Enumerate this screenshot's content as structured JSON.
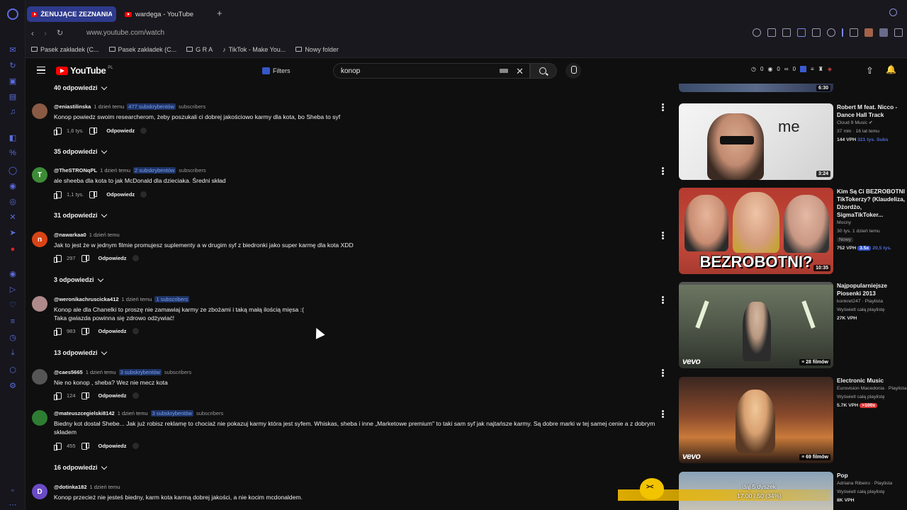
{
  "browser": {
    "tabs": [
      {
        "label": "ŻENUJĄCE ZEZNANIA STŁ"
      },
      {
        "label": "wardęga - YouTube"
      }
    ],
    "url": "www.youtube.com/watch",
    "bookmarks": [
      {
        "label": "Pasek zakładek (C..."
      },
      {
        "label": "Pasek zakładek (C..."
      },
      {
        "label": "G R A"
      },
      {
        "label": "TikTok - Make You..."
      },
      {
        "label": "Nowy folder"
      }
    ]
  },
  "youtube": {
    "logo_text": "YouTube",
    "country": "PL",
    "filters_label": "Filters",
    "search_value": "konop",
    "ext_counts": [
      "0",
      "0",
      "0"
    ]
  },
  "comments": [
    {
      "author": "@eniastilinska",
      "time": "1 dzień temu",
      "subs_highlight": "477 subskrybentów",
      "subs_tail": "subscribers",
      "text": "Konop powiedz swoim researcherom, żeby poszukali ci dobrej jakościowo karmy dla kota, bo Sheba to syf",
      "likes": "1,6 tys.",
      "reply": "Odpowiedz",
      "replies_label": "35 odpowiedzi",
      "avatar_letter": "",
      "avatar_color": "#8a5a44"
    },
    {
      "author": "@TheSTRONqPL",
      "time": "1 dzień temu",
      "subs_highlight": "2 subskrybentów",
      "subs_tail": "subscribers",
      "text": "ale sheeba dla kota to jak McDonald dla dzieciaka. Średni skład",
      "likes": "1,1 tys.",
      "reply": "Odpowiedz",
      "replies_label": "31 odpowiedzi",
      "avatar_letter": "T",
      "avatar_color": "#3d8b37"
    },
    {
      "author": "@nawarkaa0",
      "time": "1 dzień temu",
      "subs_highlight": "",
      "subs_tail": "",
      "text": "Jak to jest że w jednym filmie promujesz suplementy a w drugim syf z biedronki jako super karmę dla kota XDD",
      "likes": "297",
      "reply": "Odpowiedz",
      "replies_label": "3 odpowiedzi",
      "avatar_letter": "n",
      "avatar_color": "#d84315"
    },
    {
      "author": "@weronikachruscicka412",
      "time": "1 dzień temu",
      "subs_highlight": "1 subscribers",
      "subs_tail": "",
      "text": "Konop ale dla Chanelki to proszę nie zamawiaj karmy ze zbożami i taką małą ilością mięsa :(",
      "text2": "Taka gwiazda powinna się zdrowo odżywiać!",
      "likes": "983",
      "reply": "Odpowiedz",
      "replies_label": "13 odpowiedzi",
      "avatar_letter": "",
      "avatar_color": "#b08a8a"
    },
    {
      "author": "@caes5665",
      "time": "1 dzień temu",
      "subs_highlight": "3 subskrybentów",
      "subs_tail": "subscribers",
      "text": "Nie no konop , sheba? Wez nie mecz kota",
      "likes": "124",
      "reply": "Odpowiedz",
      "avatar_letter": "",
      "avatar_color": "#666"
    },
    {
      "author": "@mateuszcegielski8142",
      "time": "1 dzień temu",
      "subs_highlight": "3 subskrybentów",
      "subs_tail": "subscribers",
      "text": "Biedny kot dostał Shebe... Jak już robisz reklamę to chociaż nie pokazuj karmy która jest syfem. Whiskas, sheba i inne „Marketowe premium\" to taki sam syf jak najtańsze karmy. Są dobre marki w tej samej cenie a z dobrym składem",
      "likes": "455",
      "reply": "Odpowiedz",
      "replies_label": "16 odpowiedzi",
      "avatar_letter": "",
      "avatar_color": "#2e7d32"
    },
    {
      "author": "@dotinka182",
      "time": "1 dzień temu",
      "subs_highlight": "",
      "subs_tail": "",
      "text": "Konop przecież nie jesteś biedny, karm kota karmą dobrej jakości, a nie kocim mcdonaldem.",
      "avatar_letter": "D",
      "avatar_color": "#6a4bc4"
    }
  ],
  "top_replies_label": "40 odpowiedzi",
  "recommendations": [
    {
      "title": "Robert M feat. Nicco - Dance Hall Track",
      "channel": "Cloud 9 Music",
      "meta": "37 mln · 16 lat temu",
      "vph": "144 VPH",
      "extra": "321 tys. Subs",
      "duration": "3:24"
    },
    {
      "title": "Kim Są Ci BEZROBOTNI TikTokerzy? (Klaudeliza, Dżordżo, SigmaTikToker...",
      "channel": "Mocny",
      "meta": "30 tys. 1 dzień temu",
      "badge_new": "Nowy",
      "vph": "752 VPH",
      "badge": "3.5x",
      "extra": "20,5 tys.",
      "duration": "10:35",
      "overlay_text": "BEZROBOTNI?"
    },
    {
      "title": "Najpopularniejsze Piosenki 2013",
      "channel": "konkret247 · Playlista",
      "meta": "Wyświetl całą playlistę",
      "vph": "27K VPH",
      "count": "28 filmów"
    },
    {
      "title": "Electronic Music",
      "channel": "Eurovision Macedonia · Playlista",
      "meta": "Wyświetl całą playlistę",
      "vph": "5.7K VPH",
      "extra": ">100x",
      "count": "69 filmów"
    },
    {
      "title": "Pop",
      "channel": "Adriana Ribeiro · Playlista",
      "meta": "Wyświetl całą playlistę",
      "vph": "8K VPH"
    }
  ],
  "top_duration": "6:30",
  "me_say": "me",
  "vevo": "vevo",
  "overlay": {
    "line1": "dąj 5 dyszek",
    "line2": "17.00 / 50 (34%)"
  }
}
